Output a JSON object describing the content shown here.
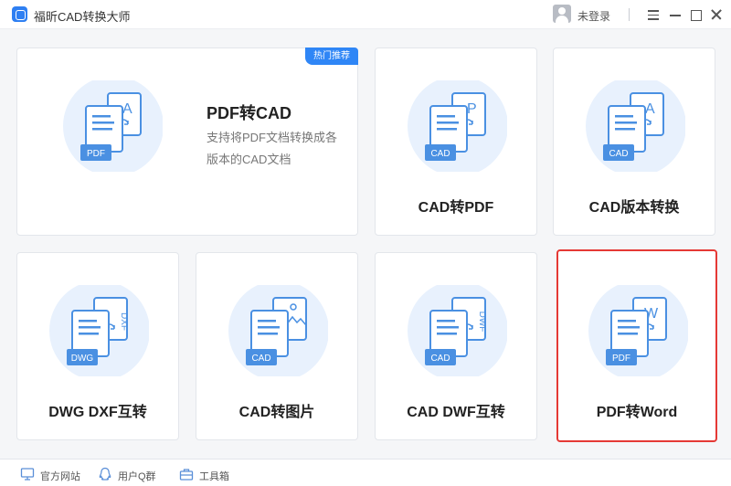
{
  "app": {
    "title": "福昕CAD转换大师"
  },
  "header": {
    "login_label": "未登录"
  },
  "featured": {
    "badge": "热门推荐",
    "title": "PDF转CAD",
    "desc_line1": "支持将PDF文档转换成各",
    "desc_line2": "版本的CAD文档",
    "icon": {
      "tag": "PDF",
      "letter": "A"
    }
  },
  "cards": [
    {
      "title": "CAD转PDF",
      "icon": {
        "tag": "CAD",
        "letter": "P"
      }
    },
    {
      "title": "CAD版本转换",
      "icon": {
        "tag": "CAD",
        "letter": "A"
      }
    },
    {
      "title": "DWG DXF互转",
      "icon": {
        "tag": "DWG",
        "letter": "DXF"
      }
    },
    {
      "title": "CAD转图片",
      "icon": {
        "tag": "CAD",
        "letter": "image"
      }
    },
    {
      "title": "CAD DWF互转",
      "icon": {
        "tag": "CAD",
        "letter": "DWF"
      }
    },
    {
      "title": "PDF转Word",
      "icon": {
        "tag": "PDF",
        "letter": "W"
      }
    }
  ],
  "footer": {
    "website_label": "官方网站",
    "qq_group_label": "用户Q群",
    "toolbox_label": "工具箱"
  },
  "colors": {
    "accent": "#2f86f6",
    "icon_blue": "#4a90e2",
    "icon_circle": "#e8f1fd",
    "selected_border": "#e53935"
  }
}
